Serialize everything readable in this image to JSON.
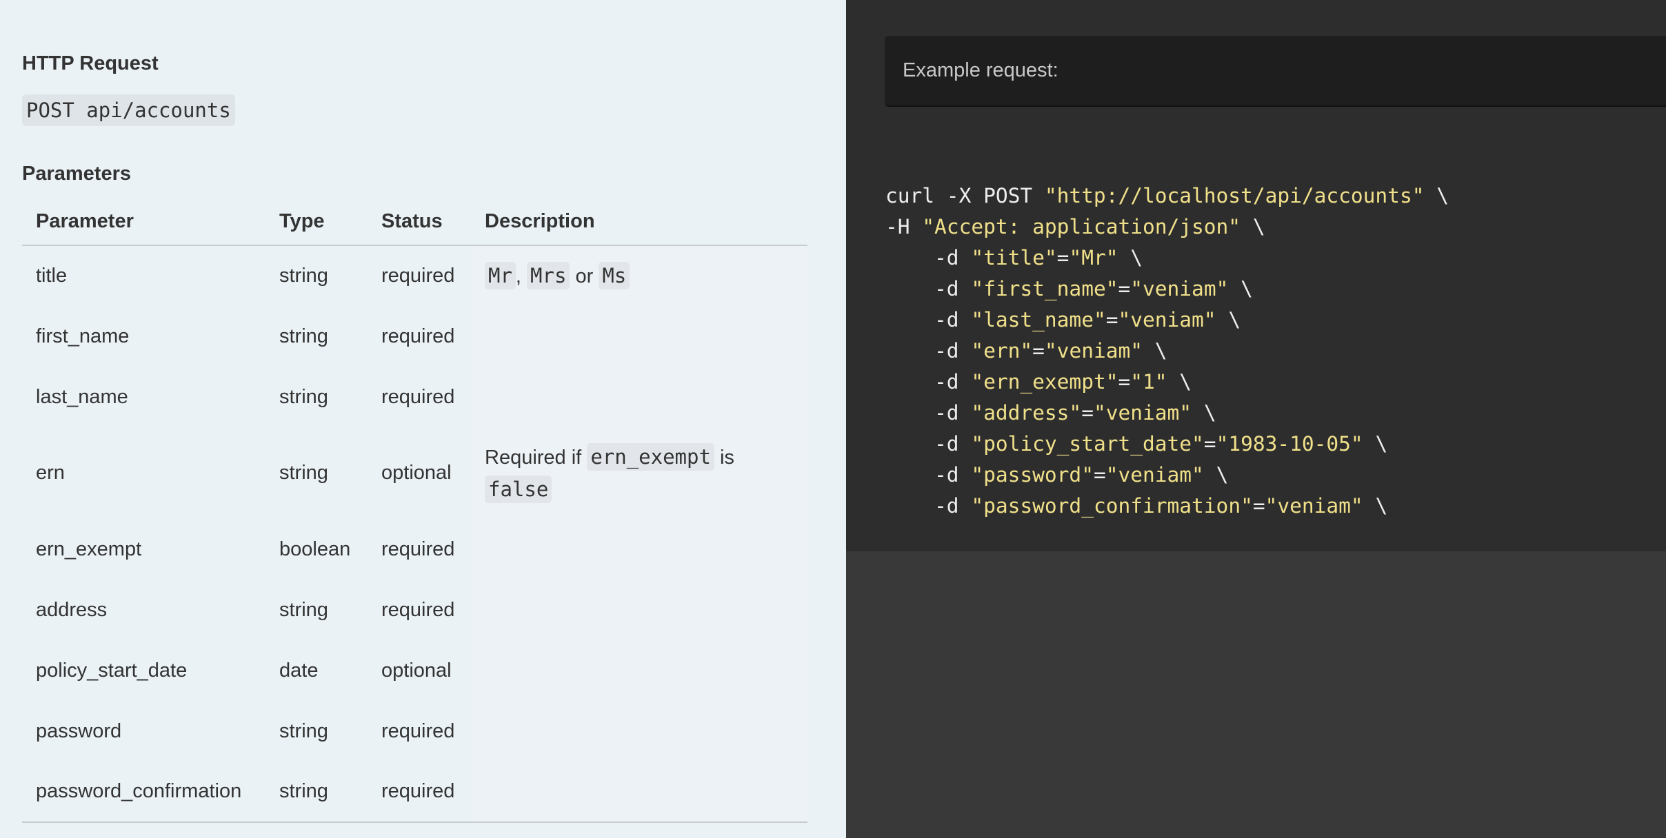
{
  "doc": {
    "http_request_heading": "HTTP Request",
    "endpoint": "POST api/accounts",
    "parameters_heading": "Parameters",
    "table": {
      "headers": [
        "Parameter",
        "Type",
        "Status",
        "Description"
      ],
      "rows": [
        {
          "parameter": "title",
          "type": "string",
          "status": "required",
          "description": {
            "chips": [
              "Mr",
              "Mrs",
              "Ms"
            ],
            "separators": [
              ", ",
              " or "
            ]
          }
        },
        {
          "parameter": "first_name",
          "type": "string",
          "status": "required",
          "description": ""
        },
        {
          "parameter": "last_name",
          "type": "string",
          "status": "required",
          "description": ""
        },
        {
          "parameter": "ern",
          "type": "string",
          "status": "optional",
          "description": {
            "prefix": "Required if ",
            "chip1": "ern_exempt",
            "middle": " is",
            "chip2": "false"
          }
        },
        {
          "parameter": "ern_exempt",
          "type": "boolean",
          "status": "required",
          "description": ""
        },
        {
          "parameter": "address",
          "type": "string",
          "status": "required",
          "description": ""
        },
        {
          "parameter": "policy_start_date",
          "type": "date",
          "status": "optional",
          "description": ""
        },
        {
          "parameter": "password",
          "type": "string",
          "status": "required",
          "description": ""
        },
        {
          "parameter": "password_confirmation",
          "type": "string",
          "status": "required",
          "description": ""
        }
      ]
    }
  },
  "code_pane": {
    "example_label": "Example request:",
    "lines": [
      {
        "indent": "",
        "flag": "curl -X POST ",
        "str": "\"http://localhost/api/accounts\"",
        "tail": " \\"
      },
      {
        "indent": "",
        "flag": "-H ",
        "str": "\"Accept: application/json\"",
        "tail": " \\"
      },
      {
        "indent": "    ",
        "flag": "-d ",
        "key": "\"title\"",
        "eq": "=",
        "val": "\"Mr\"",
        "tail": " \\"
      },
      {
        "indent": "    ",
        "flag": "-d ",
        "key": "\"first_name\"",
        "eq": "=",
        "val": "\"veniam\"",
        "tail": " \\"
      },
      {
        "indent": "    ",
        "flag": "-d ",
        "key": "\"last_name\"",
        "eq": "=",
        "val": "\"veniam\"",
        "tail": " \\"
      },
      {
        "indent": "    ",
        "flag": "-d ",
        "key": "\"ern\"",
        "eq": "=",
        "val": "\"veniam\"",
        "tail": " \\"
      },
      {
        "indent": "    ",
        "flag": "-d ",
        "key": "\"ern_exempt\"",
        "eq": "=",
        "val": "\"1\"",
        "tail": " \\"
      },
      {
        "indent": "    ",
        "flag": "-d ",
        "key": "\"address\"",
        "eq": "=",
        "val": "\"veniam\"",
        "tail": " \\"
      },
      {
        "indent": "    ",
        "flag": "-d ",
        "key": "\"policy_start_date\"",
        "eq": "=",
        "val": "\"1983-10-05\"",
        "tail": " \\"
      },
      {
        "indent": "    ",
        "flag": "-d ",
        "key": "\"password\"",
        "eq": "=",
        "val": "\"veniam\"",
        "tail": " \\"
      },
      {
        "indent": "    ",
        "flag": "-d ",
        "key": "\"password_confirmation\"",
        "eq": "=",
        "val": "\"veniam\"",
        "tail": " \\"
      }
    ]
  },
  "colors": {
    "doc_bg": "#eaf2f6",
    "code_bg": "#2d2d2d",
    "code_pane_bg": "#393939",
    "string_color": "#f0e08a"
  }
}
